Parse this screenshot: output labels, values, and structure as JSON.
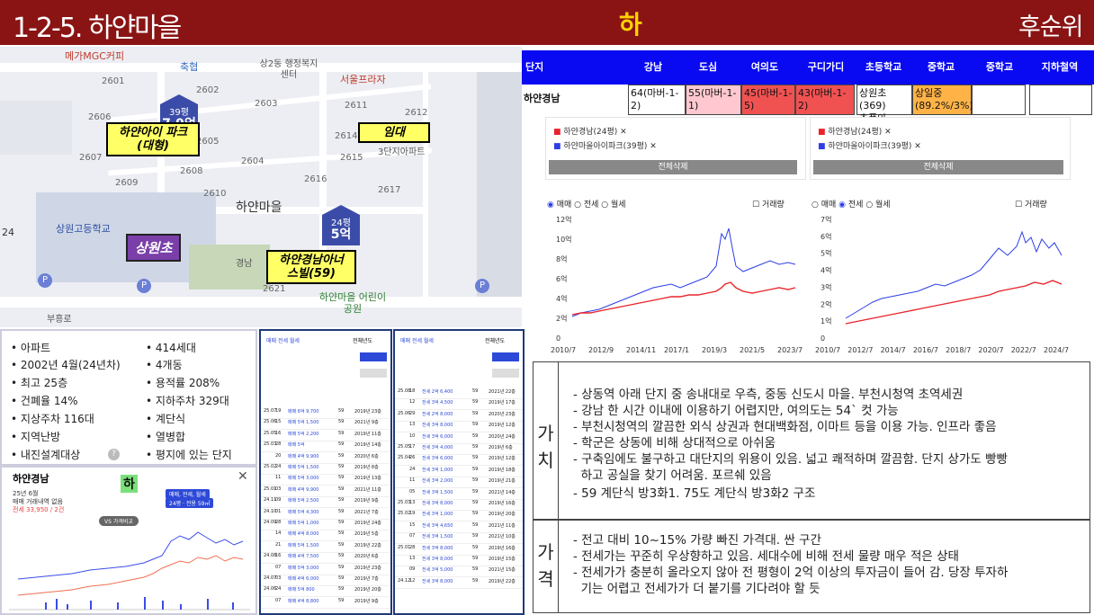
{
  "header": {
    "title": "1-2-5. 하얀마을",
    "grade": "하",
    "rank": "후순위"
  },
  "map": {
    "top_labels": [
      "메가MGC커피",
      "축협",
      "상2동 행정복지센터",
      "서울프라자"
    ],
    "blocks": [
      "2601",
      "2602",
      "2603",
      "2611",
      "2612",
      "2606",
      "2614",
      "2605",
      "2607",
      "2604",
      "2615",
      "2608",
      "2616",
      "2609",
      "2610",
      "2617",
      "2621"
    ],
    "village": "하얀마을",
    "school": "상원고등학교",
    "park": "하얀마을 어린이공원",
    "road": "부흥로",
    "side_num": "24",
    "pins": [
      {
        "size": "39평",
        "price": "7.9억"
      },
      {
        "size": "24평",
        "price": "5억"
      }
    ],
    "labels": {
      "ai_park": "하얀아이 파크(대형)",
      "imdae": "임대",
      "samsung": "3단지아파트",
      "sangwon": "상원초",
      "gyeongnam": "하얀경남아너 스빌(59)",
      "gyeongnam_small": "경남"
    }
  },
  "info": {
    "left": [
      "아파트",
      "2002년 4월(24년차)",
      "최고 25층",
      "건폐율 14%",
      "지상주차 116대",
      "지역난방",
      "내진설계대상"
    ],
    "right": [
      "414세대",
      "4개동",
      "용적률 208%",
      "지하주차 329대",
      "계단식",
      "열병합",
      "평지에 있는 단지"
    ]
  },
  "mini": {
    "title": "하얀경남",
    "grade": "하",
    "subtitle": "25년 6월",
    "line2": "매매 거래내역 없음",
    "line3": "전세 33,950 / 2건",
    "pill": "매매, 전세, 월세",
    "pill2": "24평 · 전용 59㎡",
    "tag": "VS 가격비교"
  },
  "lists": {
    "l1": {
      "tabs": "매매 전세 월세",
      "filter": "전체년도",
      "rows": [
        [
          "25.07",
          "19",
          "매매 6억 9,700",
          "59",
          "2019년 23층"
        ],
        [
          "25.06",
          "15",
          "매매 5억 1,500",
          "59",
          "2021년 9층"
        ],
        [
          "25.05",
          "16",
          "매매 5억 2,200",
          "59",
          "2019년 11층"
        ],
        [
          "25.03",
          "28",
          "매매 5억",
          "59",
          "2019년 14층"
        ],
        [
          "",
          "20",
          "매매 4억 9,900",
          "59",
          "2020년 6층"
        ],
        [
          "25.02",
          "24",
          "매매 5억 1,500",
          "59",
          "2019년 8층"
        ],
        [
          "",
          "11",
          "매매 5억 3,000",
          "59",
          "2019년 13층"
        ],
        [
          "25.01",
          "03",
          "매매 4억 9,900",
          "59",
          "2021년 11층"
        ],
        [
          "24.11",
          "09",
          "매매 5억 2,500",
          "59",
          "2019년 9층"
        ],
        [
          "24.10",
          "01",
          "매매 5억 4,300",
          "59",
          "2021년 7층"
        ],
        [
          "24.09",
          "28",
          "매매 5억 1,000",
          "59",
          "2019년 24층"
        ],
        [
          "",
          "14",
          "매매 4억 8,000",
          "59",
          "2019년 5층"
        ],
        [
          "",
          "21",
          "매매 5억 1,500",
          "59",
          "2019년 22층"
        ],
        [
          "24.08",
          "16",
          "매매 4억 7,500",
          "59",
          "2020년 6층"
        ],
        [
          "",
          "07",
          "매매 5억 3,000",
          "59",
          "2019년 23층"
        ],
        [
          "24.07",
          "03",
          "매매 4억 6,000",
          "59",
          "2019년 7층"
        ],
        [
          "24.06",
          "24",
          "매매 5억 800",
          "59",
          "2019년 20층"
        ],
        [
          "",
          "07",
          "매매 4억 8,800",
          "59",
          "2019년 9층"
        ]
      ]
    },
    "l2": {
      "tabs": "매매 전세 월세",
      "filter": "전체년도",
      "rows": [
        [
          "25.08",
          "18",
          "전세 2억 6,400",
          "59",
          "2021년 22층"
        ],
        [
          "",
          "12",
          "전세 3억 4,500",
          "59",
          "2019년 17층"
        ],
        [
          "25.06",
          "29",
          "전세 2억 8,000",
          "59",
          "2020년 23층"
        ],
        [
          "",
          "13",
          "전세 3억 8,000",
          "59",
          "2019년 12층"
        ],
        [
          "",
          "10",
          "전세 3억 6,000",
          "59",
          "2020년 24층"
        ],
        [
          "25.05",
          "17",
          "전세 3억 4,000",
          "59",
          "2019년 6층"
        ],
        [
          "25.04",
          "26",
          "전세 3억 6,000",
          "59",
          "2019년 12층"
        ],
        [
          "",
          "24",
          "전세 3억 1,000",
          "59",
          "2019년 18층"
        ],
        [
          "",
          "11",
          "전세 3억 2,000",
          "59",
          "2019년 21층"
        ],
        [
          "",
          "05",
          "전세 3억 1,500",
          "59",
          "2021년 14층"
        ],
        [
          "25.03",
          "13",
          "전세 3억 8,000",
          "59",
          "2019년 16층"
        ],
        [
          "25.02",
          "19",
          "전세 3억 1,000",
          "59",
          "2019년 20층"
        ],
        [
          "",
          "15",
          "전세 3억 4,650",
          "59",
          "2021년 11층"
        ],
        [
          "",
          "07",
          "전세 3억 1,500",
          "59",
          "2021년 10층"
        ],
        [
          "25.01",
          "28",
          "전세 3억 8,000",
          "59",
          "2019년 16층"
        ],
        [
          "",
          "13",
          "전세 3억 8,000",
          "59",
          "2019년 15층"
        ],
        [
          "",
          "09",
          "전세 3억 5,000",
          "59",
          "2021년 15층"
        ],
        [
          "24.12",
          "12",
          "전세 3억 8,000",
          "59",
          "2019년 22층"
        ]
      ]
    }
  },
  "table": {
    "headers": [
      "단지",
      "강남",
      "도심",
      "여의도",
      "구디가디",
      "초등학교",
      "중학교",
      "중학교",
      "지하철역"
    ],
    "row": {
      "name": "하얀경남",
      "gangnam": "64(마버-1-2)",
      "dosim": "55(마버-1-1)",
      "yeouido": "45(마버-1-5)",
      "gudi": "43(마버-1-2)",
      "elem": "상원초(369)",
      "elem2": "초품아",
      "middle": "상일중(89.2%/3%)"
    },
    "colors": {
      "pink": "#ffc8d0",
      "red": "#f05252",
      "orange": "#ffb347"
    }
  },
  "charts": {
    "legend1": "하얀경남(24평)",
    "legend2": "하얀마을아이파크(39평)",
    "clear": "전체삭제",
    "radio": [
      "매매",
      "전세",
      "월세"
    ],
    "volume": "거래량",
    "left": {
      "y": [
        "12억",
        "10억",
        "8억",
        "6억",
        "4억",
        "2억",
        "0"
      ],
      "x": [
        "2010/7",
        "2012/9",
        "2014/11",
        "2017/1",
        "2019/3",
        "2021/5",
        "2023/7"
      ]
    },
    "right": {
      "y": [
        "7억",
        "6억",
        "5억",
        "4억",
        "3억",
        "2억",
        "1억",
        "0"
      ],
      "x": [
        "2010/7",
        "2012/7",
        "2014/7",
        "2016/7",
        "2018/7",
        "2020/7",
        "2022/7",
        "2024/7"
      ]
    },
    "colors": {
      "red": "#e8232a",
      "blue": "#2d3ee6"
    }
  },
  "value": {
    "side": "가\n치",
    "lines": [
      "- 상동역 아래 단지 중 송내대로 우측, 중동 신도시 마을. 부천시청역 초역세권",
      "- 강남 한 시간 이내에 이용하기 어렵지만, 여의도는 54` 컷 가능",
      "- 부천시청역의 깔끔한 외식 상권과 현대백화점, 이마트 등을 이용 가능. 인프라 좋음",
      "- 학군은 상동에 비해 상대적으로 아쉬움",
      "- 구축임에도 불구하고 대단지의 위용이 있음. 넓고 쾌적하며 깔끔함. 단지 상가도 빵빵",
      "  하고 공실을 찾기 어려움. 포르쉐 있음",
      "- 59 계단식 방3화1. 75도 계단식 방3화2 구조"
    ]
  },
  "price": {
    "side": "가\n격",
    "lines": [
      "- 전고 대비 10~15% 가량 빠진 가격대. 싼 구간",
      "- 전세가는 꾸준히 우상향하고  있음. 세대수에 비해 전세 물량 매우 적은 상태",
      "- 전세가가 충분히 올라오지 않아 전 평형이 2억 이상의 투자금이 들어 감. 당장 투자하",
      "  기는 어렵고 전세가가 더 붙기를 기다려야 할 듯"
    ]
  }
}
